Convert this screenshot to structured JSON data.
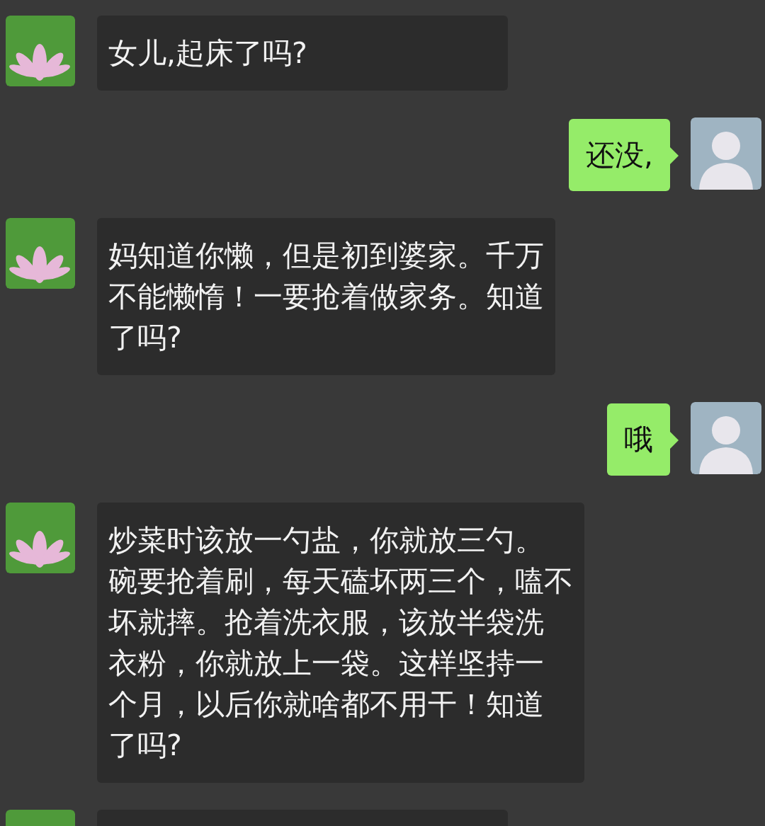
{
  "messages": [
    {
      "kind": "received",
      "lines": [
        "女儿,起床了吗?"
      ]
    },
    {
      "kind": "sent",
      "lines": [
        "还没,"
      ]
    },
    {
      "kind": "received",
      "lines": [
        "妈知道你懒，但是初到婆家。千万",
        "不能懒惰！一要抢着做家务。知道",
        "了吗?"
      ]
    },
    {
      "kind": "sent",
      "lines": [
        "哦"
      ]
    },
    {
      "kind": "received",
      "lines": [
        "炒菜时该放一勺盐，你就放三勺。",
        "碗要抢着刷，每天磕坏两三个，嗑不",
        "坏就摔。抢着洗衣服，该放半袋洗",
        "衣粉，你就放上一袋。这样坚持一",
        "个月，以后你就啥都不用干！知道",
        "了吗?"
      ]
    },
    {
      "kind": "received"
    }
  ]
}
